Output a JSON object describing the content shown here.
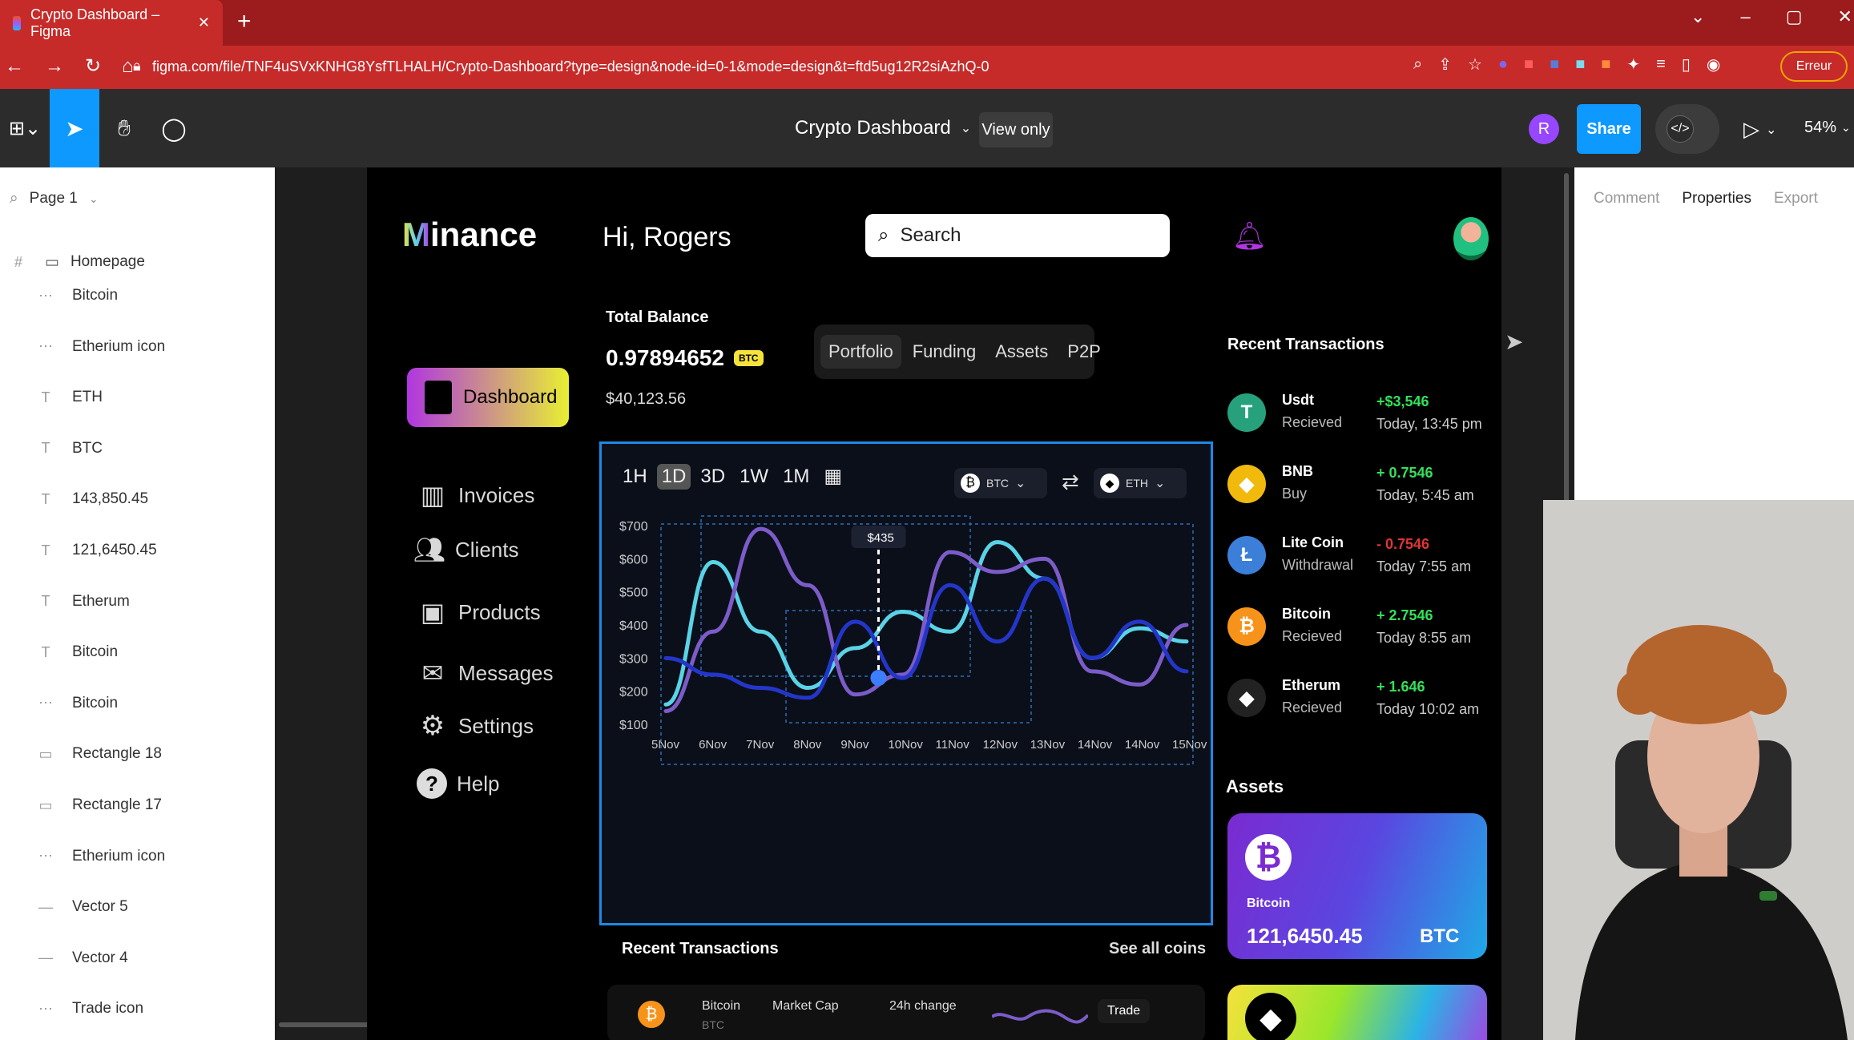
{
  "browser": {
    "tab_title": "Crypto Dashboard – Figma",
    "tab_close": "✕",
    "new_tab": "+",
    "url": "figma.com/file/TNF4uSVxKNHG8YsfTLHALH/Crypto-Dashboard?type=design&node-id=0-1&mode=design&t=ftd5ug12R2siAzhQ-0",
    "error_label": "Erreur"
  },
  "figma": {
    "file_name": "Crypto Dashboard",
    "view_only": "View only",
    "avatar_letter": "R",
    "share": "Share",
    "zoom": "54%",
    "page": "Page 1",
    "right_tabs": [
      "Comment",
      "Properties",
      "Export"
    ]
  },
  "layers": [
    {
      "name": "Homepage",
      "glyph": "#"
    },
    {
      "name": "Bitcoin",
      "glyph": "⋯"
    },
    {
      "name": "Etherium icon",
      "glyph": "⋯"
    },
    {
      "name": "ETH",
      "glyph": "T"
    },
    {
      "name": "BTC",
      "glyph": "T"
    },
    {
      "name": "143,850.45",
      "glyph": "T"
    },
    {
      "name": "121,6450.45",
      "glyph": "T"
    },
    {
      "name": "Etherum",
      "glyph": "T"
    },
    {
      "name": "Bitcoin",
      "glyph": "T"
    },
    {
      "name": "Bitcoin",
      "glyph": "⋯"
    },
    {
      "name": "Rectangle 18",
      "glyph": "▭"
    },
    {
      "name": "Rectangle 17",
      "glyph": "▭"
    },
    {
      "name": "Etherium icon",
      "glyph": "⋯"
    },
    {
      "name": "Vector 5",
      "glyph": "—"
    },
    {
      "name": "Vector 4",
      "glyph": "—"
    },
    {
      "name": "Trade icon",
      "glyph": "⋯"
    }
  ],
  "dashboard": {
    "logo": "Minance",
    "greeting": "Hi, Rogers",
    "search_placeholder": "Search",
    "total_balance_label": "Total Balance",
    "balance_btc": "0.97894652",
    "balance_badge": "BTC",
    "balance_usd": "$40,123.56",
    "tabs": [
      "Portfolio",
      "Funding",
      "Assets",
      "P2P"
    ],
    "nav": [
      "Dashboard",
      "Invoices",
      "Clients",
      "Products",
      "Messages",
      "Settings",
      "Help"
    ],
    "timeframes": [
      "1H",
      "1D",
      "3D",
      "1W",
      "1M"
    ],
    "pair_from": "BTC",
    "pair_to": "ETH",
    "tooltip": "$435",
    "recent_transactions_title": "Recent Transactions",
    "see_all": "See all coins",
    "transactions": [
      {
        "name": "Usdt",
        "status": "Recieved",
        "amount": "+$3,546",
        "time": "Today, 13:45 pm",
        "color": "#26a17b",
        "symbol": "T",
        "amount_color": "#35e05a"
      },
      {
        "name": "BNB",
        "status": "Buy",
        "amount": "+ 0.7546",
        "time": "Today, 5:45 am",
        "color": "#f0b90b",
        "symbol": "◆",
        "amount_color": "#35e05a"
      },
      {
        "name": "Lite Coin",
        "status": "Withdrawal",
        "amount": "- 0.7546",
        "time": "Today 7:55 am",
        "color": "#3b7fd9",
        "symbol": "Ł",
        "amount_color": "#e03535"
      },
      {
        "name": "Bitcoin",
        "status": "Recieved",
        "amount": "+ 2.7546",
        "time": "Today 8:55 am",
        "color": "#f7931a",
        "symbol": "₿",
        "amount_color": "#35e05a"
      },
      {
        "name": "Etherum",
        "status": "Recieved",
        "amount": "+ 1.646",
        "time": "Today 10:02 am",
        "color": "#222",
        "symbol": "◆",
        "amount_color": "#35e05a"
      }
    ],
    "assets_title": "Assets",
    "asset_card": {
      "name": "Bitcoin",
      "value": "121,6450.45",
      "ticker": "BTC"
    },
    "bottom_row": {
      "coin": "Bitcoin",
      "ticker": "BTC",
      "market_cap_label": "Market Cap",
      "change_label": "24h change",
      "trade": "Trade"
    }
  },
  "chart_data": {
    "type": "line",
    "x": [
      "5Nov",
      "6Nov",
      "7Nov",
      "8Nov",
      "9Nov",
      "10Nov",
      "11Nov",
      "12Nov",
      "13Nov",
      "14Nov",
      "14Nov",
      "15Nov"
    ],
    "y_ticks": [
      "$700",
      "$600",
      "$500",
      "$400",
      "$300",
      "$200",
      "$100"
    ],
    "ylim": [
      100,
      700
    ],
    "series": [
      {
        "color": "#5ad3e6",
        "values": [
          160,
          590,
          380,
          210,
          330,
          440,
          380,
          650,
          540,
          300,
          390,
          350
        ]
      },
      {
        "color": "#7b5cc8",
        "values": [
          140,
          380,
          690,
          520,
          190,
          250,
          620,
          560,
          600,
          260,
          220,
          400
        ]
      },
      {
        "color": "#2436c9",
        "values": [
          300,
          250,
          210,
          180,
          410,
          240,
          520,
          350,
          540,
          300,
          410,
          260
        ]
      }
    ]
  },
  "colors": {
    "figma_blue": "#0d99ff",
    "browser_red": "#c62b2a",
    "dashboard_grad": "#b036e0"
  }
}
